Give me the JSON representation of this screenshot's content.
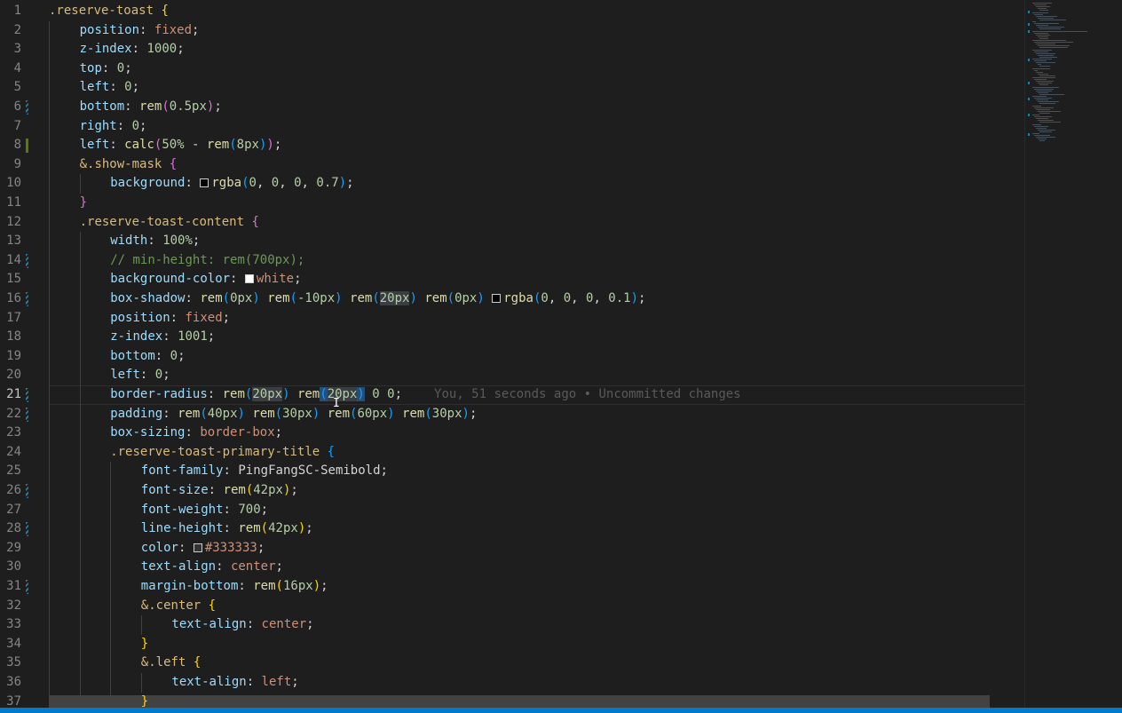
{
  "editor": {
    "active_line": 21,
    "blame_text": "You, 51 seconds ago • Uncommitted changes",
    "swatch_colors": {
      "black": "#000000",
      "white": "#ffffff",
      "dark": "#333333"
    },
    "lines": [
      {
        "n": "1",
        "g": "",
        "d": 0,
        "t": [
          [
            ".reserve-toast ",
            "t-sel"
          ],
          [
            "{",
            "t-p1"
          ]
        ]
      },
      {
        "n": "2",
        "g": "",
        "d": 1,
        "t": [
          [
            "position",
            "t-prop"
          ],
          [
            ": ",
            "t-op"
          ],
          [
            "fixed",
            "t-kw"
          ],
          [
            ";",
            "t-op"
          ]
        ]
      },
      {
        "n": "3",
        "g": "",
        "d": 1,
        "t": [
          [
            "z-index",
            "t-prop"
          ],
          [
            ": ",
            "t-op"
          ],
          [
            "1000",
            "t-num"
          ],
          [
            ";",
            "t-op"
          ]
        ]
      },
      {
        "n": "4",
        "g": "",
        "d": 1,
        "t": [
          [
            "top",
            "t-prop"
          ],
          [
            ": ",
            "t-op"
          ],
          [
            "0",
            "t-num"
          ],
          [
            ";",
            "t-op"
          ]
        ]
      },
      {
        "n": "5",
        "g": "",
        "d": 1,
        "t": [
          [
            "left",
            "t-prop"
          ],
          [
            ": ",
            "t-op"
          ],
          [
            "0",
            "t-num"
          ],
          [
            ";",
            "t-op"
          ]
        ]
      },
      {
        "n": "6",
        "g": "mod",
        "d": 1,
        "t": [
          [
            "bottom",
            "t-prop"
          ],
          [
            ": ",
            "t-op"
          ],
          [
            "rem",
            "t-fn"
          ],
          [
            "(",
            "t-p2"
          ],
          [
            "0.5px",
            "t-num"
          ],
          [
            ")",
            "t-p2"
          ],
          [
            ";",
            "t-op"
          ]
        ]
      },
      {
        "n": "7",
        "g": "",
        "d": 1,
        "t": [
          [
            "right",
            "t-prop"
          ],
          [
            ": ",
            "t-op"
          ],
          [
            "0",
            "t-num"
          ],
          [
            ";",
            "t-op"
          ]
        ]
      },
      {
        "n": "8",
        "g": "add",
        "d": 1,
        "t": [
          [
            "left",
            "t-prop"
          ],
          [
            ": ",
            "t-op"
          ],
          [
            "calc",
            "t-fn"
          ],
          [
            "(",
            "t-p2"
          ],
          [
            "50%",
            "t-num"
          ],
          [
            " - ",
            "t-op"
          ],
          [
            "rem",
            "t-fn"
          ],
          [
            "(",
            "t-p3"
          ],
          [
            "8px",
            "t-num"
          ],
          [
            ")",
            "t-p3"
          ],
          [
            ")",
            "t-p2"
          ],
          [
            ";",
            "t-op"
          ]
        ]
      },
      {
        "n": "9",
        "g": "",
        "d": 1,
        "t": [
          [
            "&.show-mask ",
            "t-sel"
          ],
          [
            "{",
            "t-p2"
          ]
        ]
      },
      {
        "n": "10",
        "g": "",
        "d": 2,
        "t": [
          [
            "background",
            "t-prop"
          ],
          [
            ": ",
            "t-op"
          ],
          [
            "",
            "sw:black"
          ],
          [
            "rgba",
            "t-fn"
          ],
          [
            "(",
            "t-p3"
          ],
          [
            "0",
            "t-num"
          ],
          [
            ", ",
            "t-op"
          ],
          [
            "0",
            "t-num"
          ],
          [
            ", ",
            "t-op"
          ],
          [
            "0",
            "t-num"
          ],
          [
            ", ",
            "t-op"
          ],
          [
            "0.7",
            "t-num"
          ],
          [
            ")",
            "t-p3"
          ],
          [
            ";",
            "t-op"
          ]
        ]
      },
      {
        "n": "11",
        "g": "",
        "d": 1,
        "t": [
          [
            "}",
            "t-p2"
          ]
        ]
      },
      {
        "n": "12",
        "g": "",
        "d": 1,
        "t": [
          [
            ".reserve-toast-content ",
            "t-sel"
          ],
          [
            "{",
            "t-p2"
          ]
        ]
      },
      {
        "n": "13",
        "g": "",
        "d": 2,
        "t": [
          [
            "width",
            "t-prop"
          ],
          [
            ": ",
            "t-op"
          ],
          [
            "100%",
            "t-num"
          ],
          [
            ";",
            "t-op"
          ]
        ]
      },
      {
        "n": "14",
        "g": "mod",
        "d": 2,
        "t": [
          [
            "// min-height: rem(700px);",
            "t-com"
          ]
        ]
      },
      {
        "n": "15",
        "g": "",
        "d": 2,
        "t": [
          [
            "background-color",
            "t-prop"
          ],
          [
            ": ",
            "t-op"
          ],
          [
            "",
            "sw:white"
          ],
          [
            "white",
            "t-kw"
          ],
          [
            ";",
            "t-op"
          ]
        ]
      },
      {
        "n": "16",
        "g": "mod",
        "d": 2,
        "t": [
          [
            "box-shadow",
            "t-prop"
          ],
          [
            ": ",
            "t-op"
          ],
          [
            "rem",
            "t-fn"
          ],
          [
            "(",
            "t-p3"
          ],
          [
            "0px",
            "t-num"
          ],
          [
            ")",
            "t-p3"
          ],
          [
            " ",
            "t-op"
          ],
          [
            "rem",
            "t-fn"
          ],
          [
            "(",
            "t-p3"
          ],
          [
            "-10px",
            "t-num"
          ],
          [
            ")",
            "t-p3"
          ],
          [
            " ",
            "t-op"
          ],
          [
            "rem",
            "t-fn"
          ],
          [
            "(",
            "t-p3"
          ],
          [
            "20px",
            "t-num hl"
          ],
          [
            ")",
            "t-p3"
          ],
          [
            " ",
            "t-op"
          ],
          [
            "rem",
            "t-fn"
          ],
          [
            "(",
            "t-p3"
          ],
          [
            "0px",
            "t-num"
          ],
          [
            ")",
            "t-p3"
          ],
          [
            " ",
            "t-op"
          ],
          [
            "",
            "sw:black"
          ],
          [
            "rgba",
            "t-fn"
          ],
          [
            "(",
            "t-p3"
          ],
          [
            "0",
            "t-num"
          ],
          [
            ", ",
            "t-op"
          ],
          [
            "0",
            "t-num"
          ],
          [
            ", ",
            "t-op"
          ],
          [
            "0",
            "t-num"
          ],
          [
            ", ",
            "t-op"
          ],
          [
            "0.1",
            "t-num"
          ],
          [
            ")",
            "t-p3"
          ],
          [
            ";",
            "t-op"
          ]
        ]
      },
      {
        "n": "17",
        "g": "",
        "d": 2,
        "t": [
          [
            "position",
            "t-prop"
          ],
          [
            ": ",
            "t-op"
          ],
          [
            "fixed",
            "t-kw"
          ],
          [
            ";",
            "t-op"
          ]
        ]
      },
      {
        "n": "18",
        "g": "",
        "d": 2,
        "t": [
          [
            "z-index",
            "t-prop"
          ],
          [
            ": ",
            "t-op"
          ],
          [
            "1001",
            "t-num"
          ],
          [
            ";",
            "t-op"
          ]
        ]
      },
      {
        "n": "19",
        "g": "",
        "d": 2,
        "t": [
          [
            "bottom",
            "t-prop"
          ],
          [
            ": ",
            "t-op"
          ],
          [
            "0",
            "t-num"
          ],
          [
            ";",
            "t-op"
          ]
        ]
      },
      {
        "n": "20",
        "g": "",
        "d": 2,
        "t": [
          [
            "left",
            "t-prop"
          ],
          [
            ": ",
            "t-op"
          ],
          [
            "0",
            "t-num"
          ],
          [
            ";",
            "t-op"
          ]
        ]
      },
      {
        "n": "21",
        "g": "mod",
        "d": 2,
        "t": [
          [
            "border-radius",
            "t-prop"
          ],
          [
            ": ",
            "t-op"
          ],
          [
            "rem",
            "t-fn"
          ],
          [
            "(",
            "t-p3"
          ],
          [
            "20px",
            "t-num hl"
          ],
          [
            ")",
            "t-p3"
          ],
          [
            " ",
            "t-op"
          ],
          [
            "rem",
            "t-fn"
          ],
          [
            "(",
            "t-p3 sel"
          ],
          [
            "20px",
            "t-num hl"
          ],
          [
            ")",
            "t-p3 sel"
          ],
          [
            " ",
            "t-op"
          ],
          [
            "0",
            "t-num"
          ],
          [
            " ",
            "t-op"
          ],
          [
            "0",
            "t-num"
          ],
          [
            ";",
            "t-op"
          ]
        ],
        "blame": true
      },
      {
        "n": "22",
        "g": "mod",
        "d": 2,
        "t": [
          [
            "padding",
            "t-prop"
          ],
          [
            ": ",
            "t-op"
          ],
          [
            "rem",
            "t-fn"
          ],
          [
            "(",
            "t-p3"
          ],
          [
            "40px",
            "t-num"
          ],
          [
            ")",
            "t-p3"
          ],
          [
            " ",
            "t-op"
          ],
          [
            "rem",
            "t-fn"
          ],
          [
            "(",
            "t-p3"
          ],
          [
            "30px",
            "t-num"
          ],
          [
            ")",
            "t-p3"
          ],
          [
            " ",
            "t-op"
          ],
          [
            "rem",
            "t-fn"
          ],
          [
            "(",
            "t-p3"
          ],
          [
            "60px",
            "t-num"
          ],
          [
            ")",
            "t-p3"
          ],
          [
            " ",
            "t-op"
          ],
          [
            "rem",
            "t-fn"
          ],
          [
            "(",
            "t-p3"
          ],
          [
            "30px",
            "t-num"
          ],
          [
            ")",
            "t-p3"
          ],
          [
            ";",
            "t-op"
          ]
        ]
      },
      {
        "n": "23",
        "g": "",
        "d": 2,
        "t": [
          [
            "box-sizing",
            "t-prop"
          ],
          [
            ": ",
            "t-op"
          ],
          [
            "border-box",
            "t-kw"
          ],
          [
            ";",
            "t-op"
          ]
        ]
      },
      {
        "n": "24",
        "g": "",
        "d": 2,
        "t": [
          [
            ".reserve-toast-primary-title ",
            "t-sel"
          ],
          [
            "{",
            "t-p3"
          ]
        ]
      },
      {
        "n": "25",
        "g": "",
        "d": 3,
        "t": [
          [
            "font-family",
            "t-prop"
          ],
          [
            ": ",
            "t-op"
          ],
          [
            "PingFangSC-Semibold",
            "t-op"
          ],
          [
            ";",
            "t-op"
          ]
        ]
      },
      {
        "n": "26",
        "g": "mod",
        "d": 3,
        "t": [
          [
            "font-size",
            "t-prop"
          ],
          [
            ": ",
            "t-op"
          ],
          [
            "rem",
            "t-fn"
          ],
          [
            "(",
            "t-p1"
          ],
          [
            "42px",
            "t-num"
          ],
          [
            ")",
            "t-p1"
          ],
          [
            ";",
            "t-op"
          ]
        ]
      },
      {
        "n": "27",
        "g": "",
        "d": 3,
        "t": [
          [
            "font-weight",
            "t-prop"
          ],
          [
            ": ",
            "t-op"
          ],
          [
            "700",
            "t-num"
          ],
          [
            ";",
            "t-op"
          ]
        ]
      },
      {
        "n": "28",
        "g": "mod",
        "d": 3,
        "t": [
          [
            "line-height",
            "t-prop"
          ],
          [
            ": ",
            "t-op"
          ],
          [
            "rem",
            "t-fn"
          ],
          [
            "(",
            "t-p1"
          ],
          [
            "42px",
            "t-num"
          ],
          [
            ")",
            "t-p1"
          ],
          [
            ";",
            "t-op"
          ]
        ]
      },
      {
        "n": "29",
        "g": "",
        "d": 3,
        "t": [
          [
            "color",
            "t-prop"
          ],
          [
            ": ",
            "t-op"
          ],
          [
            "",
            "sw:dark"
          ],
          [
            "#333333",
            "t-kw"
          ],
          [
            ";",
            "t-op"
          ]
        ]
      },
      {
        "n": "30",
        "g": "",
        "d": 3,
        "t": [
          [
            "text-align",
            "t-prop"
          ],
          [
            ": ",
            "t-op"
          ],
          [
            "center",
            "t-kw"
          ],
          [
            ";",
            "t-op"
          ]
        ]
      },
      {
        "n": "31",
        "g": "mod",
        "d": 3,
        "t": [
          [
            "margin-bottom",
            "t-prop"
          ],
          [
            ": ",
            "t-op"
          ],
          [
            "rem",
            "t-fn"
          ],
          [
            "(",
            "t-p1"
          ],
          [
            "16px",
            "t-num"
          ],
          [
            ")",
            "t-p1"
          ],
          [
            ";",
            "t-op"
          ]
        ]
      },
      {
        "n": "32",
        "g": "",
        "d": 3,
        "t": [
          [
            "&.center ",
            "t-sel"
          ],
          [
            "{",
            "t-p1"
          ]
        ]
      },
      {
        "n": "33",
        "g": "",
        "d": 4,
        "t": [
          [
            "text-align",
            "t-prop"
          ],
          [
            ": ",
            "t-op"
          ],
          [
            "center",
            "t-kw"
          ],
          [
            ";",
            "t-op"
          ]
        ]
      },
      {
        "n": "34",
        "g": "",
        "d": 3,
        "t": [
          [
            "}",
            "t-p1"
          ]
        ]
      },
      {
        "n": "35",
        "g": "",
        "d": 3,
        "t": [
          [
            "&.left ",
            "t-sel"
          ],
          [
            "{",
            "t-p1"
          ]
        ]
      },
      {
        "n": "36",
        "g": "",
        "d": 4,
        "t": [
          [
            "text-align",
            "t-prop"
          ],
          [
            ": ",
            "t-op"
          ],
          [
            "left",
            "t-kw"
          ],
          [
            ";",
            "t-op"
          ]
        ]
      },
      {
        "n": "37",
        "g": "",
        "d": 3,
        "t": [
          [
            "}",
            "t-p1"
          ]
        ]
      }
    ]
  }
}
